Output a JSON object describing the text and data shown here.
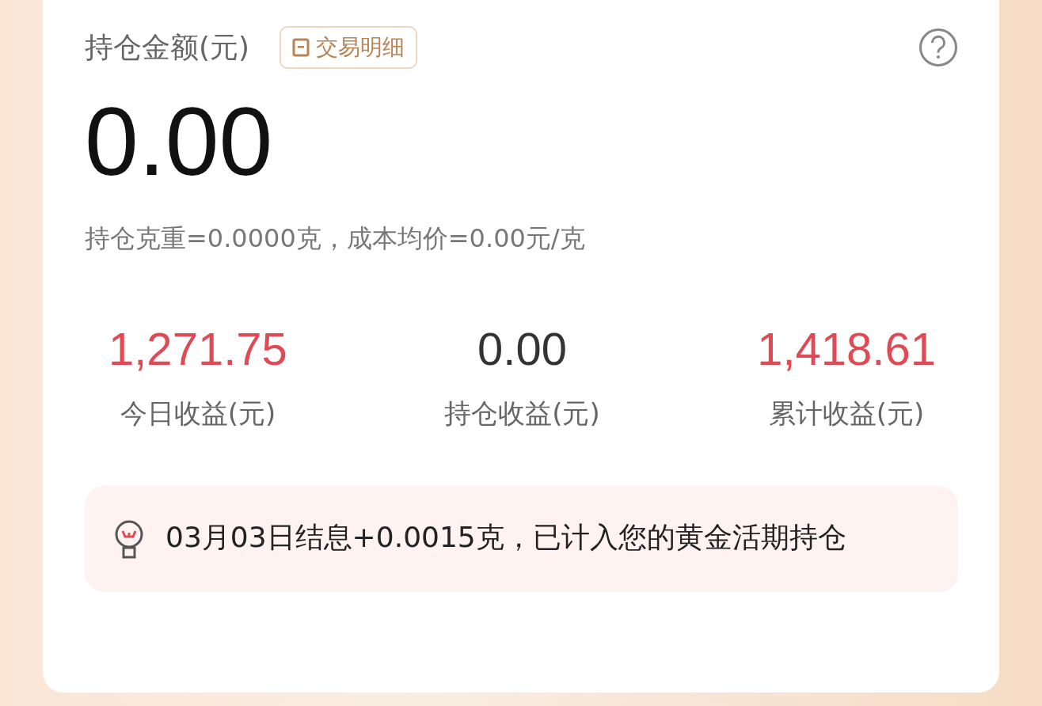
{
  "header": {
    "title": "持仓金额(元)",
    "detail_button": "交易明细"
  },
  "amount": "0.00",
  "summary": "持仓克重=0.0000克，成本均价=0.00元/克",
  "stats": [
    {
      "value": "1,271.75",
      "label": "今日收益(元)",
      "color": "#e04a55"
    },
    {
      "value": "0.00",
      "label": "持仓收益(元)",
      "color": "#333333"
    },
    {
      "value": "1,418.61",
      "label": "累计收益(元)",
      "color": "#e04a55"
    }
  ],
  "notice": "03月03日结息+0.0015克，已计入您的黄金活期持仓"
}
